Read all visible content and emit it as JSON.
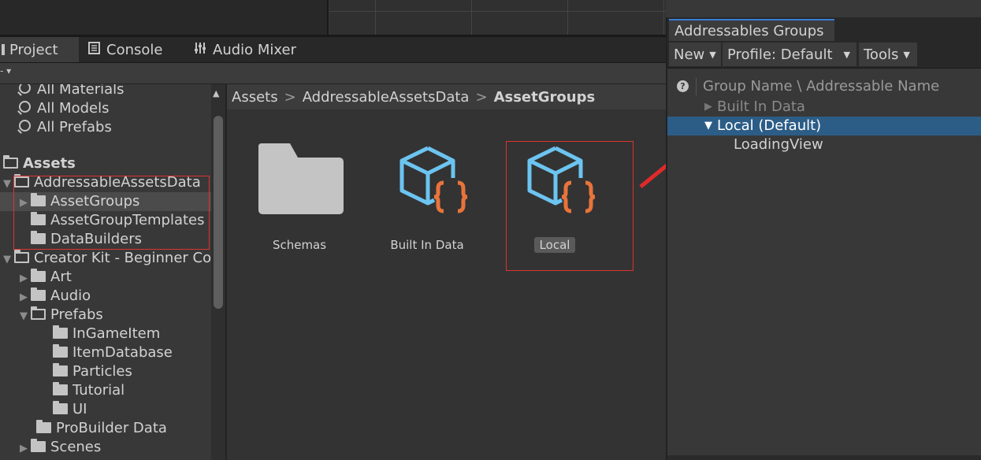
{
  "project_tabs": [
    {
      "label": "Project",
      "icon": "project-icon"
    },
    {
      "label": "Console",
      "icon": "console-icon"
    },
    {
      "label": "Audio Mixer",
      "icon": "audio-mixer-icon"
    }
  ],
  "tree": {
    "favorites": [
      "All Materials",
      "All Models",
      "All Prefabs"
    ],
    "assets_root": "Assets",
    "items": [
      {
        "label": "AddressableAssetsData"
      },
      {
        "label": "AssetGroups"
      },
      {
        "label": "AssetGroupTemplates"
      },
      {
        "label": "DataBuilders"
      },
      {
        "label": "Creator Kit - Beginner Co"
      },
      {
        "label": "Art"
      },
      {
        "label": "Audio"
      },
      {
        "label": "Prefabs"
      },
      {
        "label": "InGameItem"
      },
      {
        "label": "ItemDatabase"
      },
      {
        "label": "Particles"
      },
      {
        "label": "Tutorial"
      },
      {
        "label": "UI"
      },
      {
        "label": "ProBuilder Data"
      },
      {
        "label": "Scenes"
      }
    ]
  },
  "breadcrumb": {
    "part1": "Assets",
    "part2": "AddressableAssetsData",
    "part3": "AssetGroups",
    "sep": ">"
  },
  "assets": [
    {
      "label": "Schemas",
      "icon": "folder-icon"
    },
    {
      "label": "Built In Data",
      "icon": "asset-group-icon"
    },
    {
      "label": "Local",
      "icon": "asset-group-icon"
    }
  ],
  "addressables": {
    "tab_title": "Addressables Groups",
    "toolbar": {
      "new": "New",
      "profile": "Profile: Default",
      "tools": "Tools"
    },
    "header": "Group Name \\ Addressable Name",
    "rows": [
      {
        "label": "Built In Data"
      },
      {
        "label": "Local (Default)"
      },
      {
        "label": "LoadingView"
      }
    ]
  },
  "colors": {
    "annotation": "#d33333",
    "selection": "#2c5d87",
    "icon_blue": "#6cc4f0",
    "icon_orange": "#e8743b"
  }
}
